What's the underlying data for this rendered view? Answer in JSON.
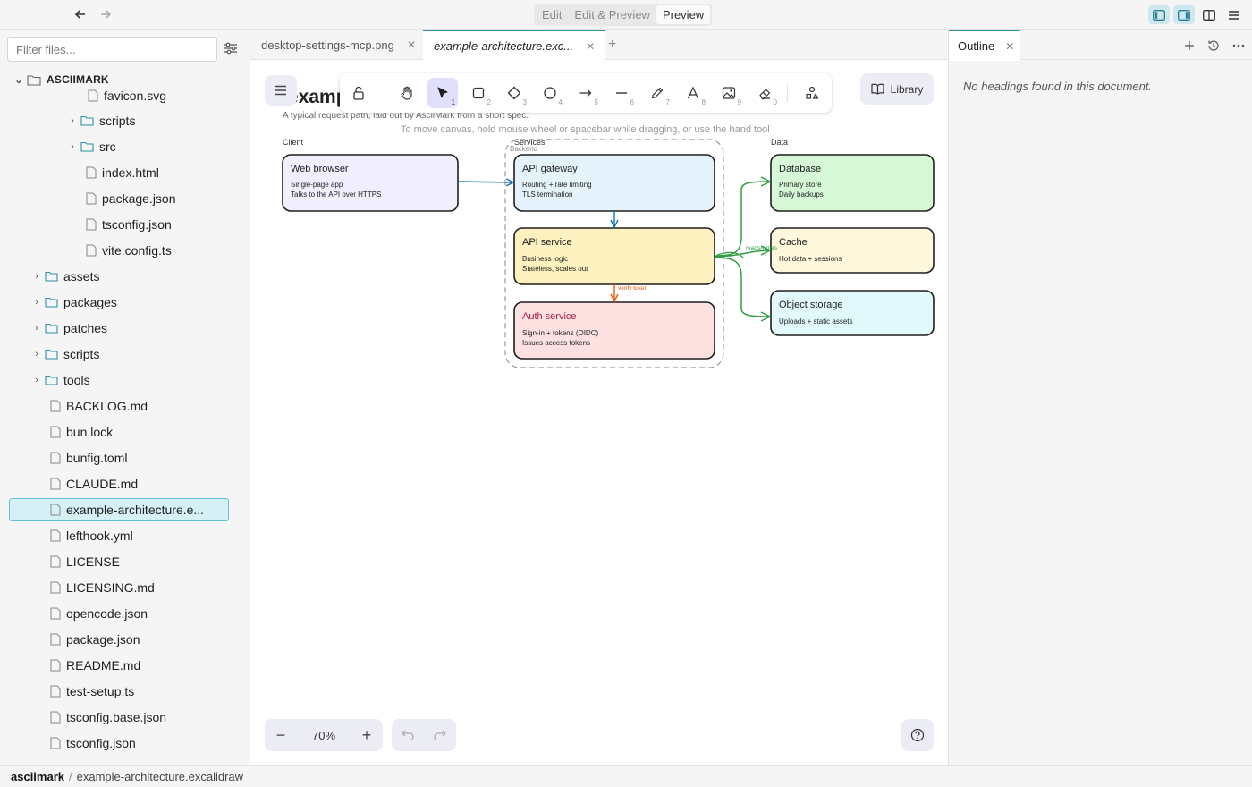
{
  "topbar": {
    "back_icon": "arrow-left-icon",
    "forward_icon": "arrow-right-icon",
    "modes": [
      "Edit",
      "Edit & Preview",
      "Preview"
    ],
    "active_mode": "Preview",
    "accent": "#2b90a8"
  },
  "sidebar": {
    "filter_placeholder": "Filter files...",
    "root": "ASCIIMARK",
    "items": [
      {
        "label": "favicon.svg",
        "type": "file"
      },
      {
        "label": "scripts",
        "type": "folder"
      },
      {
        "label": "src",
        "type": "folder"
      },
      {
        "label": "index.html",
        "type": "file"
      },
      {
        "label": "package.json",
        "type": "file"
      },
      {
        "label": "tsconfig.json",
        "type": "file"
      },
      {
        "label": "vite.config.ts",
        "type": "file"
      },
      {
        "label": "assets",
        "type": "folder"
      },
      {
        "label": "packages",
        "type": "folder"
      },
      {
        "label": "patches",
        "type": "folder"
      },
      {
        "label": "scripts",
        "type": "folder"
      },
      {
        "label": "tools",
        "type": "folder"
      },
      {
        "label": "BACKLOG.md",
        "type": "file"
      },
      {
        "label": "bun.lock",
        "type": "file"
      },
      {
        "label": "bunfig.toml",
        "type": "file"
      },
      {
        "label": "CLAUDE.md",
        "type": "file"
      },
      {
        "label": "example-architecture.e...",
        "type": "file",
        "selected": true
      },
      {
        "label": "lefthook.yml",
        "type": "file"
      },
      {
        "label": "LICENSE",
        "type": "file"
      },
      {
        "label": "LICENSING.md",
        "type": "file"
      },
      {
        "label": "opencode.json",
        "type": "file"
      },
      {
        "label": "package.json",
        "type": "file"
      },
      {
        "label": "README.md",
        "type": "file"
      },
      {
        "label": "test-setup.ts",
        "type": "file"
      },
      {
        "label": "tsconfig.base.json",
        "type": "file"
      },
      {
        "label": "tsconfig.json",
        "type": "file"
      }
    ]
  },
  "tabs": [
    {
      "label": "desktop-settings-mcp.png",
      "active": false
    },
    {
      "label": "example-architecture.exc...",
      "active": true
    }
  ],
  "canvas": {
    "doc_title": "exampl",
    "doc_subtitle": "A typical request path, laid out by AsciiMark from a short spec.",
    "hint": "To move canvas, hold mouse wheel or spacebar while dragging, or use the hand tool",
    "library_label": "Library",
    "zoom": "70%",
    "tools": [
      {
        "icon": "lock-icon",
        "num": ""
      },
      {
        "icon": "hand-icon",
        "num": ""
      },
      {
        "icon": "pointer-icon",
        "num": "1",
        "active": true
      },
      {
        "icon": "rectangle-icon",
        "num": "2"
      },
      {
        "icon": "diamond-icon",
        "num": "3"
      },
      {
        "icon": "ellipse-icon",
        "num": "4"
      },
      {
        "icon": "arrow-icon",
        "num": "5"
      },
      {
        "icon": "line-icon",
        "num": "6"
      },
      {
        "icon": "pencil-icon",
        "num": "7"
      },
      {
        "icon": "text-icon",
        "num": "8"
      },
      {
        "icon": "image-icon",
        "num": "9"
      },
      {
        "icon": "eraser-icon",
        "num": "0"
      },
      {
        "icon": "shapes-icon",
        "num": ""
      }
    ]
  },
  "diagram": {
    "groups": {
      "client": "Client",
      "services": "Services",
      "backend": "Backend",
      "data": "Data"
    },
    "nodes": {
      "web_browser": {
        "title": "Web browser",
        "line1": "Single-page app",
        "line2": "Talks to the API over HTTPS",
        "fill": "#f0eeff"
      },
      "api_gateway": {
        "title": "API gateway",
        "line1": "Routing + rate limiting",
        "line2": "TLS termination",
        "fill": "#e4f2fc"
      },
      "api_service": {
        "title": "API service",
        "line1": "Business logic",
        "line2": "Stateless, scales out",
        "fill": "#fdf1bf"
      },
      "auth_service": {
        "title": "Auth service",
        "line1": "Sign-in + tokens (OIDC)",
        "line2": "Issues access tokens",
        "fill": "#fde1e1"
      },
      "database": {
        "title": "Database",
        "line1": "Primary store",
        "line2": "Daily backups",
        "fill": "#d6f8d6"
      },
      "cache": {
        "title": "Cache",
        "line1": "Hot data + sessions",
        "fill": "#fdf8dc"
      },
      "object_storage": {
        "title": "Object storage",
        "line1": "Uploads + static assets",
        "fill": "#e1f9fb"
      }
    },
    "edge_labels": {
      "verify": "verify token",
      "reads": "reads/writes"
    },
    "colors": {
      "blue": "#1971c2",
      "orange": "#e8590c",
      "green": "#2f9e44"
    }
  },
  "outline": {
    "tab_label": "Outline",
    "empty_text": "No headings found in this document."
  },
  "statusbar": {
    "workspace": "asciimark",
    "separator": "/",
    "path": "example-architecture.excalidraw"
  }
}
